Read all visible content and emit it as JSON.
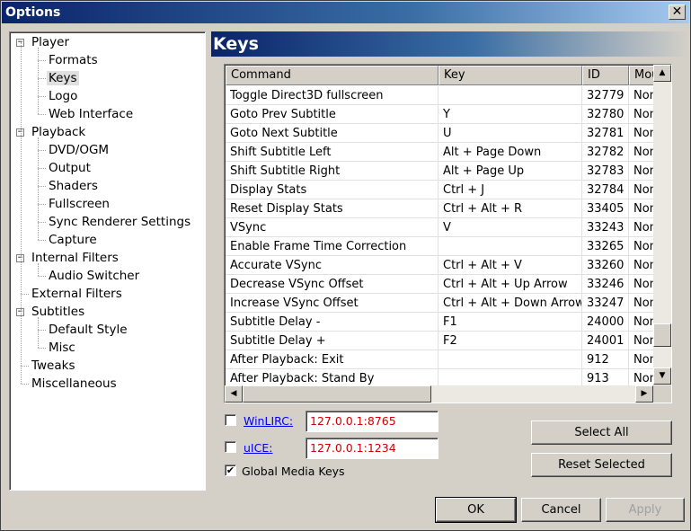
{
  "window": {
    "title": "Options",
    "close_glyph": "✕"
  },
  "tree": {
    "items": [
      {
        "label": "Player",
        "level": 0,
        "expander": "−"
      },
      {
        "label": "Formats",
        "level": 1
      },
      {
        "label": "Keys",
        "level": 1,
        "selected": true
      },
      {
        "label": "Logo",
        "level": 1
      },
      {
        "label": "Web Interface",
        "level": 1
      },
      {
        "label": "Playback",
        "level": 0,
        "expander": "−"
      },
      {
        "label": "DVD/OGM",
        "level": 1
      },
      {
        "label": "Output",
        "level": 1
      },
      {
        "label": "Shaders",
        "level": 1
      },
      {
        "label": "Fullscreen",
        "level": 1
      },
      {
        "label": "Sync Renderer Settings",
        "level": 1
      },
      {
        "label": "Capture",
        "level": 1
      },
      {
        "label": "Internal Filters",
        "level": 0,
        "expander": "−"
      },
      {
        "label": "Audio Switcher",
        "level": 1
      },
      {
        "label": "External Filters",
        "level": 0
      },
      {
        "label": "Subtitles",
        "level": 0,
        "expander": "−"
      },
      {
        "label": "Default Style",
        "level": 1
      },
      {
        "label": "Misc",
        "level": 1
      },
      {
        "label": "Tweaks",
        "level": 0
      },
      {
        "label": "Miscellaneous",
        "level": 0
      }
    ]
  },
  "page": {
    "title": "Keys"
  },
  "grid": {
    "columns": [
      "Command",
      "Key",
      "ID",
      "Mou"
    ],
    "rows": [
      [
        "Toggle Direct3D fullscreen",
        "",
        "32779",
        "Non"
      ],
      [
        "Goto Prev Subtitle",
        "Y",
        "32780",
        "Non"
      ],
      [
        "Goto Next Subtitle",
        "U",
        "32781",
        "Non"
      ],
      [
        "Shift Subtitle Left",
        "Alt + Page Down",
        "32782",
        "Non"
      ],
      [
        "Shift Subtitle Right",
        "Alt + Page Up",
        "32783",
        "Non"
      ],
      [
        "Display Stats",
        "Ctrl + J",
        "32784",
        "Non"
      ],
      [
        "Reset Display Stats",
        "Ctrl + Alt + R",
        "33405",
        "Non"
      ],
      [
        "VSync",
        "V",
        "33243",
        "Non"
      ],
      [
        "Enable Frame Time Correction",
        "",
        "33265",
        "Non"
      ],
      [
        "Accurate VSync",
        "Ctrl + Alt + V",
        "33260",
        "Non"
      ],
      [
        "Decrease VSync Offset",
        "Ctrl + Alt + Up Arrow",
        "33246",
        "Non"
      ],
      [
        "Increase VSync Offset",
        "Ctrl + Alt + Down Arrow",
        "33247",
        "Non"
      ],
      [
        "Subtitle Delay -",
        "F1",
        "24000",
        "Non"
      ],
      [
        "Subtitle Delay +",
        "F2",
        "24001",
        "Non"
      ],
      [
        "After Playback: Exit",
        "",
        "912",
        "Non"
      ],
      [
        "After Playback: Stand By",
        "",
        "913",
        "Non"
      ]
    ],
    "scroll_up_glyph": "▲",
    "scroll_down_glyph": "▼",
    "scroll_left_glyph": "◀",
    "scroll_right_glyph": "▶"
  },
  "remote": {
    "winlirc": {
      "label": "WinLIRC:",
      "value": "127.0.0.1:8765",
      "checked": false
    },
    "uice": {
      "label": "uICE:",
      "value": "127.0.0.1:1234",
      "checked": false
    },
    "global_keys": {
      "label": "Global Media Keys",
      "checked": true,
      "check_glyph": "✔"
    }
  },
  "buttons": {
    "select_all": "Select All",
    "reset_selected": "Reset Selected",
    "ok": "OK",
    "cancel": "Cancel",
    "apply": "Apply"
  }
}
